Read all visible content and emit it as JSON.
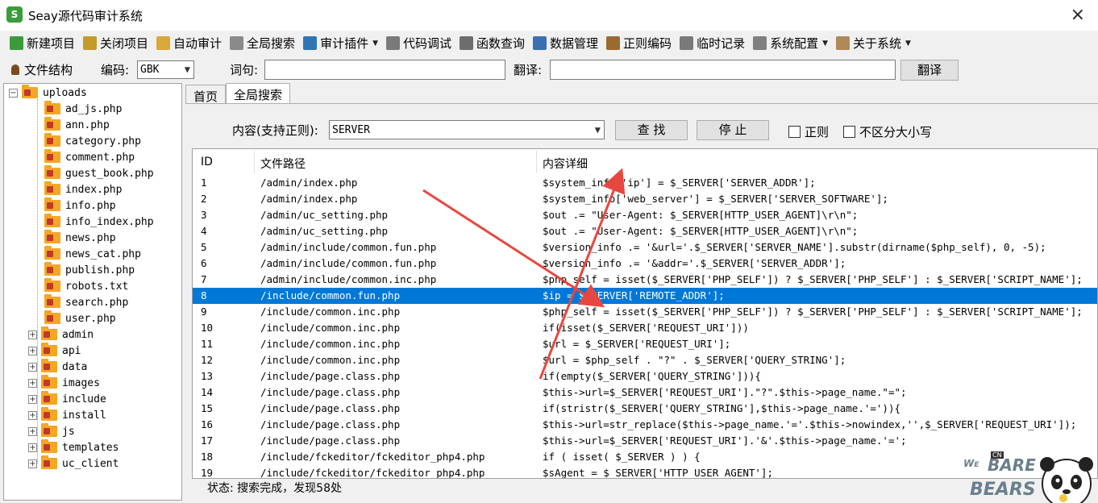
{
  "window": {
    "title": "Seay源代码审计系统",
    "close_glyph": "×"
  },
  "menu": [
    {
      "label": "新建项目",
      "icon": "new-project-icon",
      "color": "#3c9a3c",
      "has_caret": false
    },
    {
      "label": "关闭项目",
      "icon": "close-project-icon",
      "color": "#c49a2a",
      "has_caret": false
    },
    {
      "label": "自动审计",
      "icon": "auto-audit-icon",
      "color": "#d9a83a",
      "has_caret": false
    },
    {
      "label": "全局搜索",
      "icon": "global-search-icon",
      "color": "#8a8a8a",
      "has_caret": false
    },
    {
      "label": "审计插件",
      "icon": "audit-plugin-icon",
      "color": "#2e75b6",
      "has_caret": true
    },
    {
      "label": "代码调试",
      "icon": "code-debug-icon",
      "color": "#7a7a7a",
      "has_caret": false
    },
    {
      "label": "函数查询",
      "icon": "function-query-icon",
      "color": "#6d6d6d",
      "has_caret": false
    },
    {
      "label": "数据管理",
      "icon": "data-manage-icon",
      "color": "#3a6fb0",
      "has_caret": false
    },
    {
      "label": "正则编码",
      "icon": "regex-encode-icon",
      "color": "#9a6a30",
      "has_caret": false
    },
    {
      "label": "临时记录",
      "icon": "temp-record-icon",
      "color": "#7a7a7a",
      "has_caret": false
    },
    {
      "label": "系统配置",
      "icon": "settings-gear-icon",
      "color": "#808080",
      "has_caret": true
    },
    {
      "label": "关于系统",
      "icon": "about-icon",
      "color": "#b0895a",
      "has_caret": true
    }
  ],
  "toolbar": {
    "file_structure_label": "文件结构",
    "encoding_label": "编码:",
    "encoding_value": "GBK",
    "word_label": "词句:",
    "word_value": "",
    "translate_label": "翻译:",
    "translate_value": "",
    "translate_button": "翻译"
  },
  "tree": {
    "root": "uploads",
    "files": [
      "ad_js.php",
      "ann.php",
      "category.php",
      "comment.php",
      "guest_book.php",
      "index.php",
      "info.php",
      "info_index.php",
      "news.php",
      "news_cat.php",
      "publish.php",
      "robots.txt",
      "search.php",
      "user.php"
    ],
    "folders": [
      "admin",
      "api",
      "data",
      "images",
      "include",
      "install",
      "js",
      "templates",
      "uc_client"
    ]
  },
  "tabs": [
    {
      "label": "首页",
      "active": false
    },
    {
      "label": "全局搜索",
      "active": true
    }
  ],
  "search": {
    "content_label": "内容(支持正则):",
    "content_value": "SERVER",
    "find_button": "查 找",
    "stop_button": "停 止",
    "regex_checkbox": "正则",
    "ignore_case_checkbox": "不区分大小写"
  },
  "results": {
    "headers": [
      "ID",
      "文件路径",
      "内容详细"
    ],
    "selected_row": 8,
    "rows": [
      {
        "id": "1",
        "path": "/admin/index.php",
        "content": "$system_info['ip'] = $_SERVER['SERVER_ADDR'];"
      },
      {
        "id": "2",
        "path": "/admin/index.php",
        "content": "$system_info['web_server'] = $_SERVER['SERVER_SOFTWARE'];"
      },
      {
        "id": "3",
        "path": "/admin/uc_setting.php",
        "content": "$out .= \"User-Agent: $_SERVER[HTTP_USER_AGENT]\\r\\n\";"
      },
      {
        "id": "4",
        "path": "/admin/uc_setting.php",
        "content": "$out .= \"User-Agent: $_SERVER[HTTP_USER_AGENT]\\r\\n\";"
      },
      {
        "id": "5",
        "path": "/admin/include/common.fun.php",
        "content": "$version_info .= '&url='.$_SERVER['SERVER_NAME'].substr(dirname($php_self), 0, -5);"
      },
      {
        "id": "6",
        "path": "/admin/include/common.fun.php",
        "content": "$version_info .= '&addr='.$_SERVER['SERVER_ADDR'];"
      },
      {
        "id": "7",
        "path": "/admin/include/common.inc.php",
        "content": "$php_self = isset($_SERVER['PHP_SELF']) ? $_SERVER['PHP_SELF'] : $_SERVER['SCRIPT_NAME'];"
      },
      {
        "id": "8",
        "path": "/include/common.fun.php",
        "content": "$ip = $_SERVER['REMOTE_ADDR'];"
      },
      {
        "id": "9",
        "path": "/include/common.inc.php",
        "content": "$php_self = isset($_SERVER['PHP_SELF']) ? $_SERVER['PHP_SELF'] : $_SERVER['SCRIPT_NAME'];"
      },
      {
        "id": "10",
        "path": "/include/common.inc.php",
        "content": "if(isset($_SERVER['REQUEST_URI']))"
      },
      {
        "id": "11",
        "path": "/include/common.inc.php",
        "content": "$url = $_SERVER['REQUEST_URI'];"
      },
      {
        "id": "12",
        "path": "/include/common.inc.php",
        "content": "$url = $php_self . \"?\" . $_SERVER['QUERY_STRING'];"
      },
      {
        "id": "13",
        "path": "/include/page.class.php",
        "content": "if(empty($_SERVER['QUERY_STRING'])){"
      },
      {
        "id": "14",
        "path": "/include/page.class.php",
        "content": "$this->url=$_SERVER['REQUEST_URI'].\"?\".$this->page_name.\"=\";"
      },
      {
        "id": "15",
        "path": "/include/page.class.php",
        "content": "if(stristr($_SERVER['QUERY_STRING'],$this->page_name.'=')){"
      },
      {
        "id": "16",
        "path": "/include/page.class.php",
        "content": "$this->url=str_replace($this->page_name.'='.$this->nowindex,'',$_SERVER['REQUEST_URI']);"
      },
      {
        "id": "17",
        "path": "/include/page.class.php",
        "content": "$this->url=$_SERVER['REQUEST_URI'].'&'.$this->page_name.'=';"
      },
      {
        "id": "18",
        "path": "/include/fckeditor/fckeditor_php4.php",
        "content": "if ( isset( $_SERVER ) ) {"
      },
      {
        "id": "19",
        "path": "/include/fckeditor/fckeditor_php4.php",
        "content": "$sAgent = $_SERVER['HTTP_USER_AGENT'];"
      }
    ]
  },
  "status": "状态: 搜索完成，发现58处",
  "watermark": {
    "top": "WE BARE",
    "bottom": "BEARS",
    "badge": "CN"
  },
  "colors": {
    "selection": "#0078d7",
    "annotation_arrow": "#e8473f",
    "folder": "#f5a623"
  }
}
